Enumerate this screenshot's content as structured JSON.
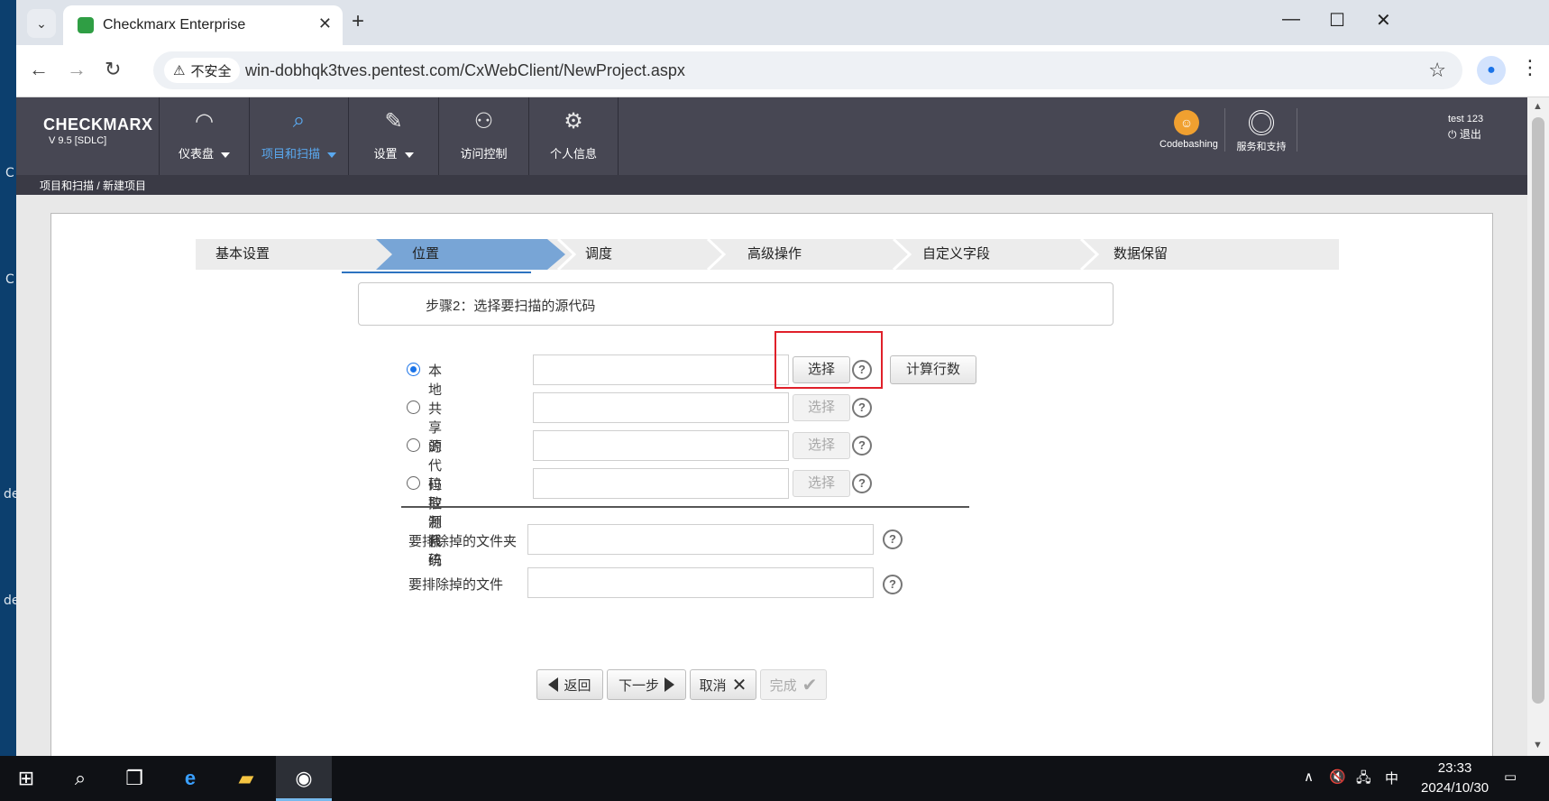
{
  "desktop": {
    "side_letters": [
      "C",
      "C",
      "de",
      "de"
    ]
  },
  "browser": {
    "tab_title": "Checkmarx Enterprise",
    "security_label": "不安全",
    "url": "win-dobhqk3tves.pentest.com/CxWebClient/NewProject.aspx"
  },
  "app": {
    "logo": "CHECKMARX",
    "version": "V 9.5  [SDLC]",
    "nav": [
      {
        "label": "仪表盘"
      },
      {
        "label": "项目和扫描"
      },
      {
        "label": "设置"
      },
      {
        "label": "访问控制"
      },
      {
        "label": "个人信息"
      }
    ],
    "codebashing_label": "Codebashing",
    "support_label": "服务和支持",
    "user_name": "test 123",
    "logout_label": "退出",
    "breadcrumb": "项目和扫描 / 新建项目"
  },
  "wizard": {
    "steps": [
      "基本设置",
      "位置",
      "调度",
      "高级操作",
      "自定义字段",
      "数据保留"
    ],
    "active_step": "位置",
    "step_title": "步骤2：选择要扫描的源代码"
  },
  "source": {
    "options": [
      {
        "label": "本地",
        "selected": true,
        "select_button": "选择"
      },
      {
        "label": "共享的",
        "selected": false,
        "select_button": "选择"
      },
      {
        "label": "源代码控制系统",
        "selected": false,
        "select_button": "选择"
      },
      {
        "label": "拉取源代码",
        "selected": false,
        "select_button": "选择"
      }
    ],
    "count_lines_button": "计算行数",
    "help_glyph": "?"
  },
  "exclude": {
    "folders_label": "要排除掉的文件夹",
    "files_label": "要排除掉的文件"
  },
  "footer": {
    "back": "返回",
    "next": "下一步",
    "cancel": "取消",
    "finish": "完成"
  },
  "taskbar": {
    "ime": "中",
    "time": "23:33",
    "date": "2024/10/30"
  },
  "colors": {
    "header_bg": "#474753",
    "active_nav": "#5aa9f0",
    "active_step": "#78a5d6",
    "highlight": "#e0202a"
  }
}
